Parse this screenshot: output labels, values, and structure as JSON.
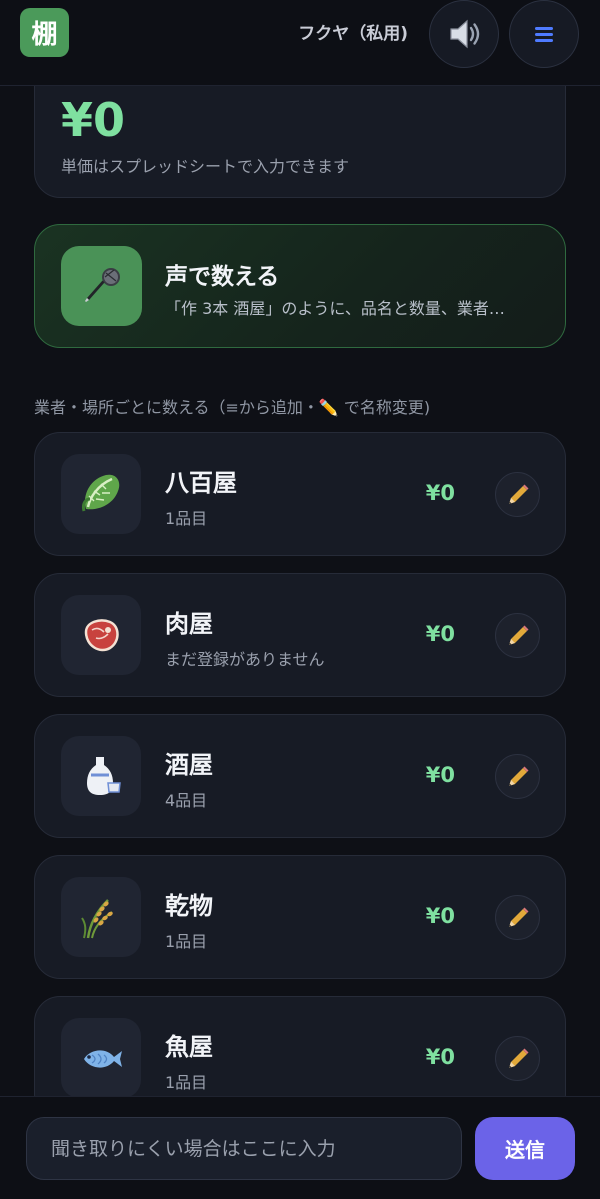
{
  "header": {
    "logo_text": "棚",
    "account_name": "フクヤ（私用)",
    "sound_icon": "speaker-icon",
    "menu_icon": "hamburger-menu-icon"
  },
  "total": {
    "amount": "¥0",
    "note": "単価はスプレッドシートで入力できます"
  },
  "voice": {
    "title": "声で数える",
    "description": "「作 3本 酒屋」のように、品名と数量、業者…",
    "icon": "microphone-icon"
  },
  "section_label": "業者・場所ごとに数える（≡から追加・✏️ で名称変更)",
  "vendors": [
    {
      "name": "八百屋",
      "sub": "1品目",
      "amount": "¥0",
      "icon": "lettuce-icon"
    },
    {
      "name": "肉屋",
      "sub": "まだ登録がありません",
      "amount": "¥0",
      "icon": "meat-icon"
    },
    {
      "name": "酒屋",
      "sub": "4品目",
      "amount": "¥0",
      "icon": "sake-bottle-icon"
    },
    {
      "name": "乾物",
      "sub": "1品目",
      "amount": "¥0",
      "icon": "rice-ear-icon"
    },
    {
      "name": "魚屋",
      "sub": "1品目",
      "amount": "¥0",
      "icon": "fish-icon"
    }
  ],
  "input_bar": {
    "placeholder": "聞き取りにくい場合はここに入力",
    "send_label": "送信"
  },
  "colors": {
    "accent_green": "#7fe0a0",
    "logo_green": "#4b9a5a",
    "send_purple": "#6b63e8",
    "menu_blue": "#4f7bff"
  }
}
